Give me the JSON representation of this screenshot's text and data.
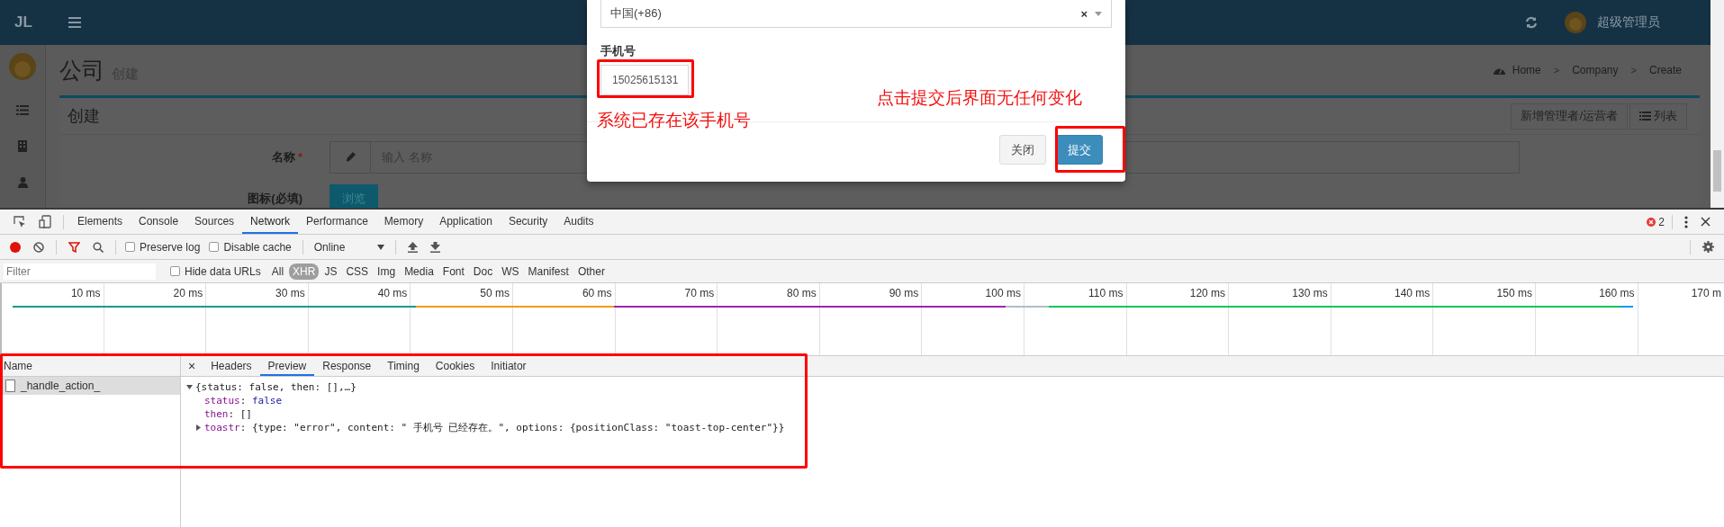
{
  "header": {
    "logo": "JL",
    "user": "超级管理员"
  },
  "page": {
    "title": "公司",
    "subtitle": "创建",
    "breadcrumb": [
      "Home",
      "Company",
      "Create"
    ],
    "breadcrumb_separator": ">",
    "required_mark": "*",
    "box_title": "创建",
    "box_buttons": [
      "新增管理者/运营者",
      "列表"
    ],
    "fields": [
      {
        "kind": "text",
        "label": "名称",
        "required": true,
        "placeholder": "输入 名称"
      },
      {
        "kind": "file",
        "label": "图标(必填)",
        "required": false,
        "button": "浏览"
      }
    ]
  },
  "modal": {
    "select_value": "中国(+86)",
    "select_clear": "×",
    "phone_label": "手机号",
    "phone_value": "15025615131",
    "buttons": [
      {
        "label": "关闭",
        "kind": "default"
      },
      {
        "label": "提交",
        "kind": "primary"
      }
    ]
  },
  "annotations": [
    "系统已存在该手机号",
    "点击提交后界面无任何变化"
  ],
  "devtools": {
    "tabs": [
      {
        "label": "Elements",
        "selected": false
      },
      {
        "label": "Console",
        "selected": false
      },
      {
        "label": "Sources",
        "selected": false
      },
      {
        "label": "Network",
        "selected": true
      },
      {
        "label": "Performance",
        "selected": false
      },
      {
        "label": "Memory",
        "selected": false
      },
      {
        "label": "Application",
        "selected": false
      },
      {
        "label": "Security",
        "selected": false
      },
      {
        "label": "Audits",
        "selected": false
      }
    ],
    "error_count": "2",
    "checkboxes": [
      {
        "label": "Preserve log",
        "checked": false
      },
      {
        "label": "Disable cache",
        "checked": false
      }
    ],
    "throttle": "Online",
    "filter_placeholder": "Filter",
    "hide_data_urls": {
      "label": "Hide data URLs",
      "checked": false
    },
    "types": [
      {
        "label": "All",
        "selected": false
      },
      {
        "label": "XHR",
        "selected": true
      },
      {
        "label": "JS",
        "selected": false
      },
      {
        "label": "CSS",
        "selected": false
      },
      {
        "label": "Img",
        "selected": false
      },
      {
        "label": "Media",
        "selected": false
      },
      {
        "label": "Font",
        "selected": false
      },
      {
        "label": "Doc",
        "selected": false
      },
      {
        "label": "WS",
        "selected": false
      },
      {
        "label": "Manifest",
        "selected": false
      },
      {
        "label": "Other",
        "selected": false
      }
    ],
    "timeline_ticks": [
      "10 ms",
      "20 ms",
      "30 ms",
      "40 ms",
      "50 ms",
      "60 ms",
      "70 ms",
      "80 ms",
      "90 ms",
      "100 ms",
      "110 ms",
      "120 ms",
      "130 ms",
      "140 ms",
      "150 ms",
      "160 ms",
      "170 m"
    ],
    "name_header": "Name",
    "requests": [
      {
        "name": "_handle_action_",
        "selected": true
      }
    ],
    "detail_close": "×",
    "detail_tabs": [
      {
        "label": "Headers",
        "selected": false
      },
      {
        "label": "Preview",
        "selected": true
      },
      {
        "label": "Response",
        "selected": false
      },
      {
        "label": "Timing",
        "selected": false
      },
      {
        "label": "Cookies",
        "selected": false
      },
      {
        "label": "Initiator",
        "selected": false
      }
    ],
    "preview": {
      "summary": "{status: false, then: [],…}",
      "expanded": true,
      "key_separator": ":",
      "properties": [
        {
          "key": "status",
          "value": "false",
          "kind": "bool",
          "expandable": false
        },
        {
          "key": "then",
          "value": "[]",
          "kind": "plain",
          "expandable": false
        },
        {
          "key": "toastr",
          "value": "{type: \"error\", content: \" 手机号 已经存在。\", options: {positionClass: \"toast-top-center\"}}",
          "kind": "plain",
          "expandable": true
        }
      ]
    }
  }
}
